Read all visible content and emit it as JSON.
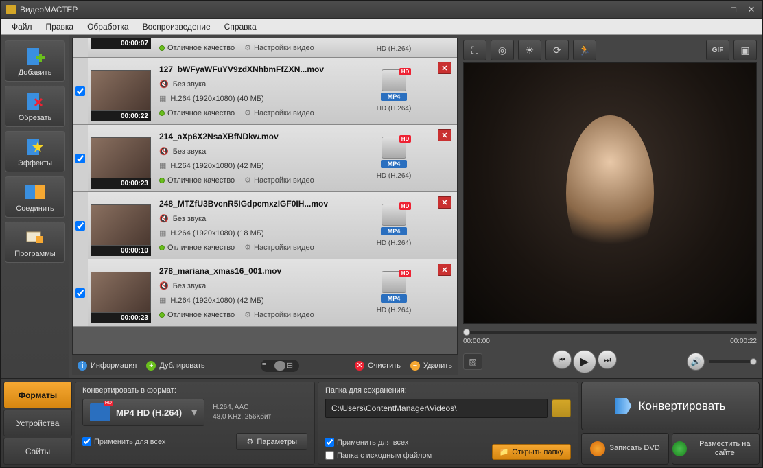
{
  "app": {
    "title": "ВидеоМАСТЕР"
  },
  "menu": [
    "Файл",
    "Правка",
    "Обработка",
    "Воспроизведение",
    "Справка"
  ],
  "sidebar": [
    {
      "label": "Добавить",
      "icon": "add"
    },
    {
      "label": "Обрезать",
      "icon": "cut"
    },
    {
      "label": "Эффекты",
      "icon": "fx"
    },
    {
      "label": "Соединить",
      "icon": "join"
    },
    {
      "label": "Программы",
      "icon": "apps"
    }
  ],
  "files": [
    {
      "partial": true,
      "duration": "00:00:07",
      "quality": "Отличное качество",
      "settings": "Настройки видео",
      "codec": "HD (H.264)"
    },
    {
      "name": "127_bWFyaWFuYV9zdXNhbmFfZXN...mov",
      "duration": "00:00:22",
      "audio": "Без звука",
      "info": "H.264 (1920x1080) (40 МБ)",
      "quality": "Отличное качество",
      "settings": "Настройки видео",
      "fmt": "MP4",
      "codec": "HD (H.264)"
    },
    {
      "name": "214_aXp6X2NsaXBfNDkw.mov",
      "duration": "00:00:23",
      "audio": "Без звука",
      "info": "H.264 (1920x1080) (42 МБ)",
      "quality": "Отличное качество",
      "settings": "Настройки видео",
      "fmt": "MP4",
      "codec": "HD (H.264)"
    },
    {
      "name": "248_MTZfU3BvcnR5IGdpcmxzIGF0IH...mov",
      "duration": "00:00:10",
      "audio": "Без звука",
      "info": "H.264 (1920x1080) (18 МБ)",
      "quality": "Отличное качество",
      "settings": "Настройки видео",
      "fmt": "MP4",
      "codec": "HD (H.264)"
    },
    {
      "name": "278_mariana_xmas16_001.mov",
      "duration": "00:00:23",
      "audio": "Без звука",
      "info": "H.264 (1920x1080) (42 МБ)",
      "quality": "Отличное качество",
      "settings": "Настройки видео",
      "fmt": "MP4",
      "codec": "HD (H.264)"
    }
  ],
  "listtoolbar": {
    "info": "Информация",
    "duplicate": "Дублировать",
    "clear": "Очистить",
    "delete": "Удалить"
  },
  "player": {
    "time_current": "00:00:00",
    "time_total": "00:00:22"
  },
  "bottom": {
    "tabs": [
      "Форматы",
      "Устройства",
      "Сайты"
    ],
    "conv_header": "Конвертировать в формат:",
    "fmt_name": "MP4 HD (H.264)",
    "fmt_spec1": "H.264, AAC",
    "fmt_spec2": "48,0 KHz, 256Кбит",
    "apply_all": "Применить для всех",
    "params": "Параметры",
    "save_header": "Папка для сохранения:",
    "save_path": "C:\\Users\\ContentManager\\Videos\\",
    "apply_all2": "Применить для всех",
    "source_folder": "Папка с исходным файлом",
    "open_folder": "Открыть папку",
    "convert": "Конвертировать",
    "burn_dvd": "Записать DVD",
    "publish": "Разместить на сайте"
  }
}
